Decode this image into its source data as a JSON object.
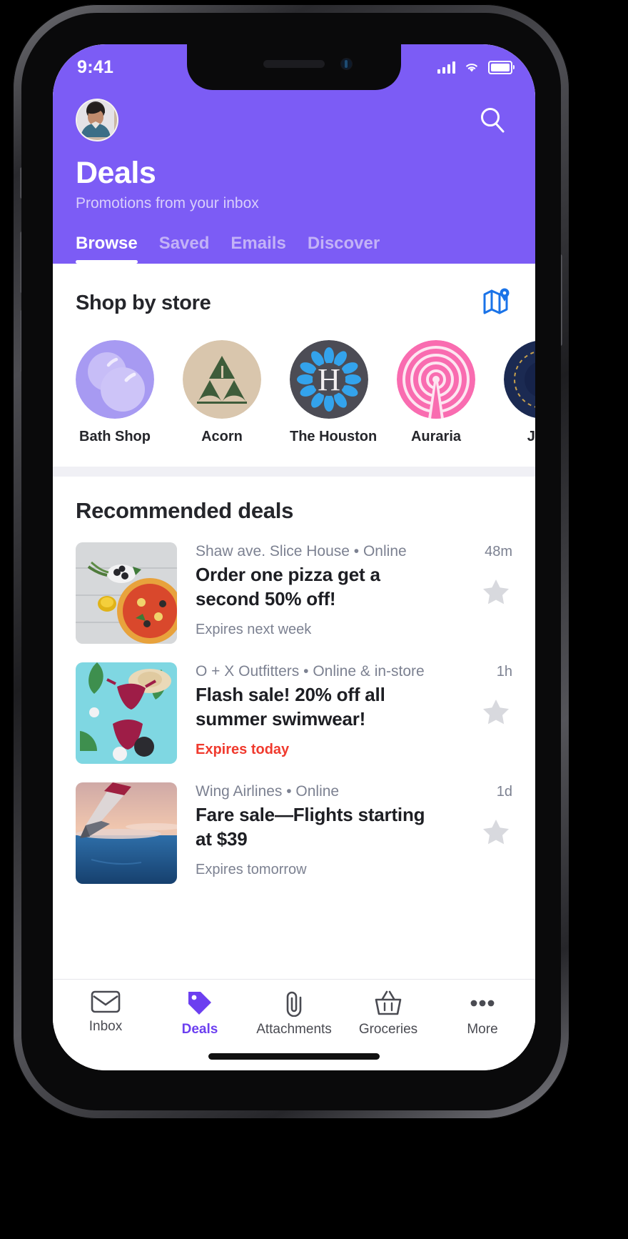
{
  "status_bar": {
    "time": "9:41",
    "signal_icon": "cellular-bars-icon",
    "wifi_icon": "wifi-icon",
    "battery_icon": "battery-full-icon"
  },
  "header": {
    "avatar_name": "user-avatar",
    "search_icon": "search-icon",
    "title": "Deals",
    "subtitle": "Promotions from your inbox",
    "accent_color": "#7c5cf5",
    "tabs": [
      {
        "label": "Browse",
        "active": true
      },
      {
        "label": "Saved",
        "active": false
      },
      {
        "label": "Emails",
        "active": false
      },
      {
        "label": "Discover",
        "active": false
      }
    ]
  },
  "stores_section": {
    "title": "Shop by store",
    "map_icon": "map-pin-icon",
    "map_icon_color": "#1a73e8",
    "stores": [
      {
        "name": "Bath Shop",
        "logo": "bubbles-logo-icon",
        "bg": "#a79af2"
      },
      {
        "name": "Acorn",
        "logo": "triangles-trees-logo-icon",
        "bg": "#d9c6ad"
      },
      {
        "name": "The Houston",
        "logo": "letter-h-wreath-logo-icon",
        "bg": "#4c4c55"
      },
      {
        "name": "Auraria",
        "logo": "broadcast-tower-logo-icon",
        "bg": "#f96cb0"
      },
      {
        "name": "Jack",
        "logo": "dark-blue-logo-icon",
        "bg": "#1b2a52"
      }
    ]
  },
  "deals_section": {
    "title": "Recommended deals",
    "deals": [
      {
        "thumb": "pizza-photo",
        "store": "Shaw ave. Slice House • Online",
        "name": "Order one pizza get a second 50% off!",
        "expires": "Expires next week",
        "urgent": false,
        "time": "48m",
        "star_icon": "star-icon"
      },
      {
        "thumb": "swimwear-photo",
        "store": "O + X Outfitters • Online & in-store",
        "name": "Flash sale! 20% off all summer swimwear!",
        "expires": "Expires today",
        "urgent": true,
        "time": "1h",
        "star_icon": "star-icon"
      },
      {
        "thumb": "airplane-wing-photo",
        "store": "Wing Airlines • Online",
        "name": "Fare sale—Flights starting at $39",
        "expires": "Expires tomorrow",
        "urgent": false,
        "time": "1d",
        "star_icon": "star-icon"
      }
    ]
  },
  "bottom_nav": {
    "active_color": "#6c3ff0",
    "items": [
      {
        "label": "Inbox",
        "icon": "envelope-icon",
        "active": false
      },
      {
        "label": "Deals",
        "icon": "tag-icon",
        "active": true
      },
      {
        "label": "Attachments",
        "icon": "paperclip-icon",
        "active": false
      },
      {
        "label": "Groceries",
        "icon": "basket-icon",
        "active": false
      },
      {
        "label": "More",
        "icon": "ellipsis-icon",
        "active": false
      }
    ]
  }
}
